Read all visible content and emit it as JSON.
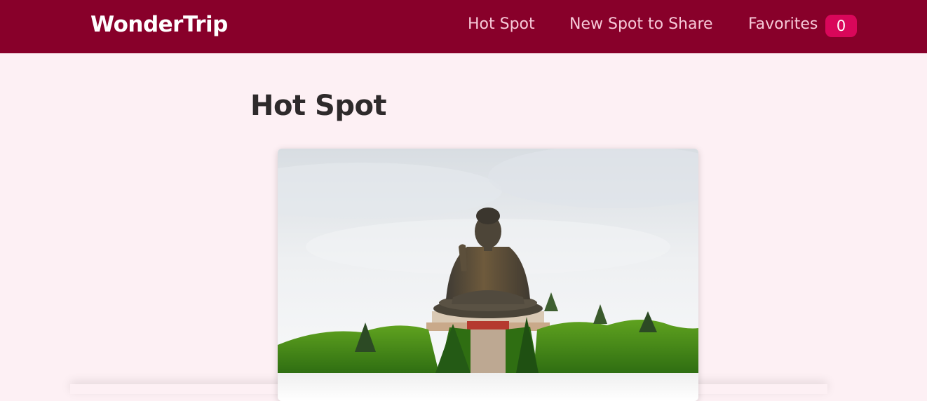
{
  "header": {
    "logo": "WonderTrip",
    "nav": {
      "hot_spot": "Hot Spot",
      "new_spot": "New Spot to Share",
      "favorites": "Favorites",
      "favorites_count": "0"
    }
  },
  "main": {
    "title": "Hot Spot"
  },
  "colors": {
    "header_bg": "#88002a",
    "page_bg": "#fdf0f4",
    "badge_bg": "#d9075a",
    "nav_text": "#f7c9d8"
  }
}
